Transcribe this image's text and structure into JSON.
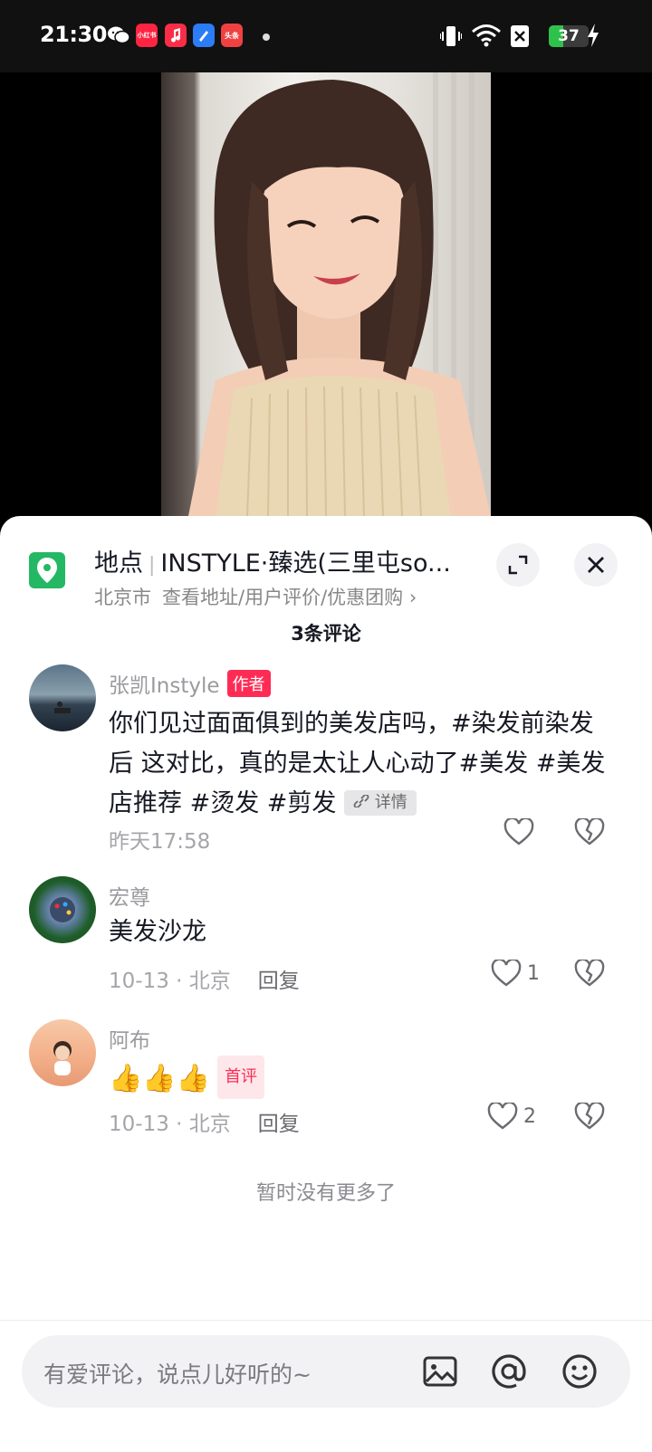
{
  "status_bar": {
    "time": "21:30",
    "apps": [
      {
        "name": "wechat-icon",
        "label": ""
      },
      {
        "name": "xiaohongshu-icon",
        "label": "小红书"
      },
      {
        "name": "music-icon",
        "label": ""
      },
      {
        "name": "browser-icon",
        "label": ""
      },
      {
        "name": "toutiao-icon",
        "label": "头条"
      }
    ],
    "battery_level": "37",
    "battery_percent": 37
  },
  "location": {
    "label": "地点",
    "name": "INSTYLE·臻选(三里屯so...",
    "city": "北京市",
    "link_text": "查看地址/用户评价/优惠团购",
    "link_arrow": "›"
  },
  "comments_header": {
    "count_text": "3条评论"
  },
  "comments": [
    {
      "username": "张凯Instyle",
      "badge": "作者",
      "text": "你们见过面面俱到的美发店吗，#染发前染发后 这对比，真的是太让人心动了#美发 #美发店推荐 #烫发 #剪发",
      "detail_chip": "详情",
      "time": "昨天17:58",
      "likes": ""
    },
    {
      "username": "宏尊",
      "text": "美发沙龙",
      "date": "10-13 · 北京",
      "reply_label": "回复",
      "likes": "1"
    },
    {
      "username": "阿布",
      "emoji_text": "👍👍👍",
      "badge": "首评",
      "date": "10-13 · 北京",
      "reply_label": "回复",
      "likes": "2"
    }
  ],
  "no_more_text": "暂时没有更多了",
  "input": {
    "placeholder": "有爱评论，说点儿好听的~"
  },
  "colors": {
    "brand_red": "#fe2c55",
    "location_green": "#25b864",
    "battery_green": "#2fc24b"
  }
}
